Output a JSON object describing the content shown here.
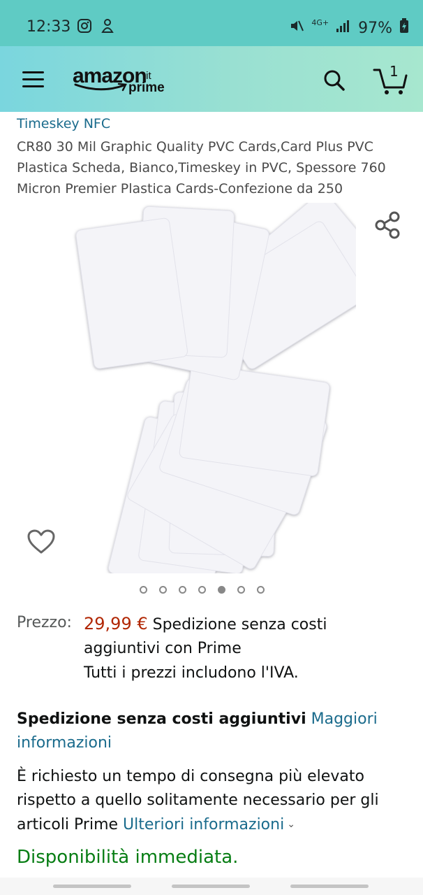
{
  "status_bar": {
    "time": "12:33",
    "network": "4G+",
    "battery": "97%"
  },
  "header": {
    "logo": {
      "wordmark": "amazon",
      "tld": ".it",
      "sub": "prime"
    },
    "cart_count": "1"
  },
  "product": {
    "brand": "Timeskey NFC",
    "title": "CR80 30 Mil Graphic Quality PVC Cards,Card Plus PVC Plastica Scheda, Bianco,Timeskey in PVC, Spessore 760 Micron Premier Plastica Cards-Confezione da 250",
    "image_count": 7,
    "active_image_index": 4
  },
  "pricing": {
    "label": "Prezzo:",
    "value": "29,99 €",
    "shipping_note": "Spedizione senza costi aggiuntivi con Prime",
    "vat_note": "Tutti i prezzi includono l'IVA."
  },
  "delivery": {
    "bold": "Spedizione senza costi aggiuntivi",
    "link": "Maggiori informazioni",
    "notice_text": "È richiesto un tempo di consegna più elevato rispetto a quello solitamente necessario per gli articoli Prime",
    "notice_link": "Ulteriori informazioni"
  },
  "availability": "Disponibilità immediata.",
  "colors": {
    "status_bar": "#5fcbc4",
    "link": "#1a6b8c",
    "price": "#b12704",
    "availability": "#067d13"
  }
}
